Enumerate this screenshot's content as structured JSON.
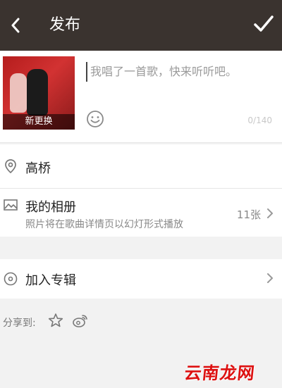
{
  "header": {
    "title": "发布"
  },
  "compose": {
    "text": "我唱了一首歌，快来听听吧。",
    "change_cover_label": "新更换",
    "counter": "0/140"
  },
  "location": {
    "label": "高桥"
  },
  "album": {
    "label": "我的相册",
    "sub": "照片将在歌曲详情页以幻灯形式播放",
    "count": "11张"
  },
  "join_album": {
    "label": "加入专辑"
  },
  "share": {
    "label": "分享到:",
    "icons": [
      "star-icon",
      "weibo-icon"
    ]
  },
  "watermark": {
    "text": "云南龙网"
  },
  "colors": {
    "header_bg": "#3a332f",
    "background": "#f2f2f2",
    "watermark": "#dd1111"
  }
}
